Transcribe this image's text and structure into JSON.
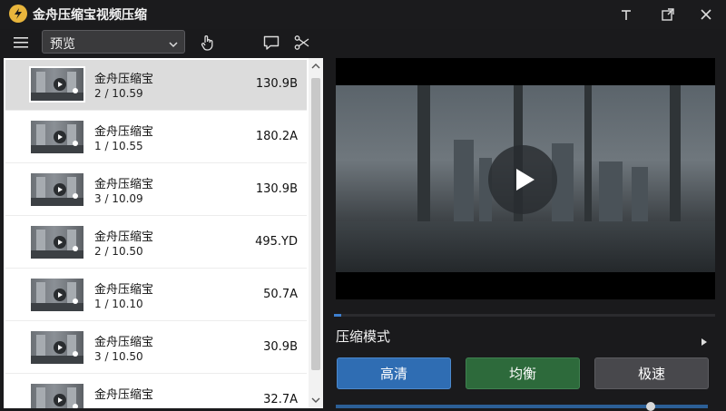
{
  "app": {
    "title": "金舟压缩宝视频压缩"
  },
  "toolbar": {
    "view_select": "预览"
  },
  "list": {
    "items": [
      {
        "name": "金舟压缩宝",
        "meta": "2 / 10.59",
        "size": "130.9B"
      },
      {
        "name": "金舟压缩宝",
        "meta": "1 / 10.55",
        "size": "180.2A"
      },
      {
        "name": "金舟压缩宝",
        "meta": "3 / 10.09",
        "size": "130.9B"
      },
      {
        "name": "金舟压缩宝",
        "meta": "2 / 10.50",
        "size": "495.YD"
      },
      {
        "name": "金舟压缩宝",
        "meta": "1 / 10.10",
        "size": "50.7A"
      },
      {
        "name": "金舟压缩宝",
        "meta": "3 / 10.50",
        "size": "30.9B"
      },
      {
        "name": "金舟压缩宝",
        "meta": "",
        "size": "32.7A"
      }
    ]
  },
  "compress": {
    "section_title": "压缩模式",
    "modes": {
      "high": "高清",
      "balanced": "均衡",
      "fast": "极速"
    },
    "progress_fraction": 0.02
  },
  "colors": {
    "accent": "#2f6db3",
    "balanced": "#2d6a3b",
    "neutral_button": "#48484c",
    "logo": "#e8b53c"
  },
  "icons": [
    "logo-icon",
    "pin-icon",
    "restore-icon",
    "close-icon",
    "menu-icon",
    "chevron-down-icon",
    "hand-icon",
    "comment-icon",
    "scissors-icon",
    "play-icon",
    "chevron-right-icon",
    "chevron-up-icon"
  ]
}
